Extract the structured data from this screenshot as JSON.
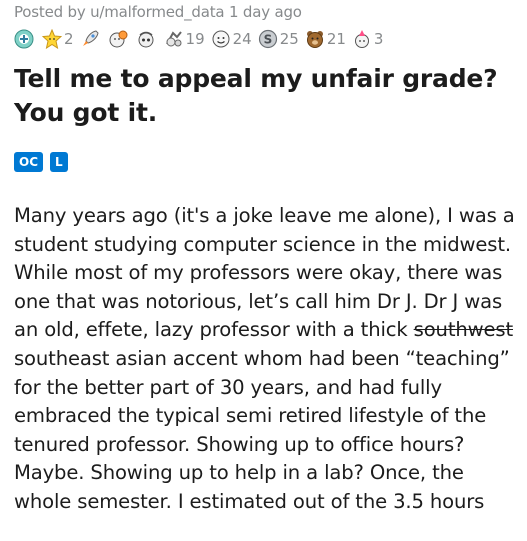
{
  "post": {
    "meta": "Posted by u/malformed_data 1 day ago",
    "awards": [
      {
        "icon": "helpful-award-icon",
        "count": ""
      },
      {
        "icon": "wholesome-award-icon",
        "count": "2"
      },
      {
        "icon": "rocket-award-icon",
        "count": ""
      },
      {
        "icon": "hugz-award-icon",
        "count": ""
      },
      {
        "icon": "ally-award-icon",
        "count": ""
      },
      {
        "icon": "take-my-energy-award-icon",
        "count": "19"
      },
      {
        "icon": "wholesome-seal-award-icon",
        "count": "24"
      },
      {
        "icon": "silver-coin-award-icon",
        "count": "25"
      },
      {
        "icon": "bear-award-icon",
        "count": "21"
      },
      {
        "icon": "party-train-award-icon",
        "count": "3"
      }
    ],
    "title_line1": "Tell me to appeal my unfair grade?",
    "title_line2": "You got it.",
    "tags": [
      "OC",
      "L"
    ],
    "body": {
      "l1": "Many years ago (it's a joke leave me alone), I was a",
      "l2": "student studying computer science in the midwest.",
      "l3": "While most of my professors were okay, there was",
      "l4": "one that was notorious, let’s call him Dr J. Dr J was",
      "l5_a": "an old, effete, lazy professor with a thick ",
      "l5_strike": "southwest",
      "l6": "southeast asian accent whom had been “teaching”",
      "l7": "for the better part of 30 years, and had fully",
      "l8": "embraced the typical semi retired lifestyle of the",
      "l9": "tenured professor. Showing up to office hours?",
      "l10": "Maybe. Showing up to help in a lab? Once, the",
      "l11": "whole semester. I estimated out of the 3.5 hours"
    }
  }
}
